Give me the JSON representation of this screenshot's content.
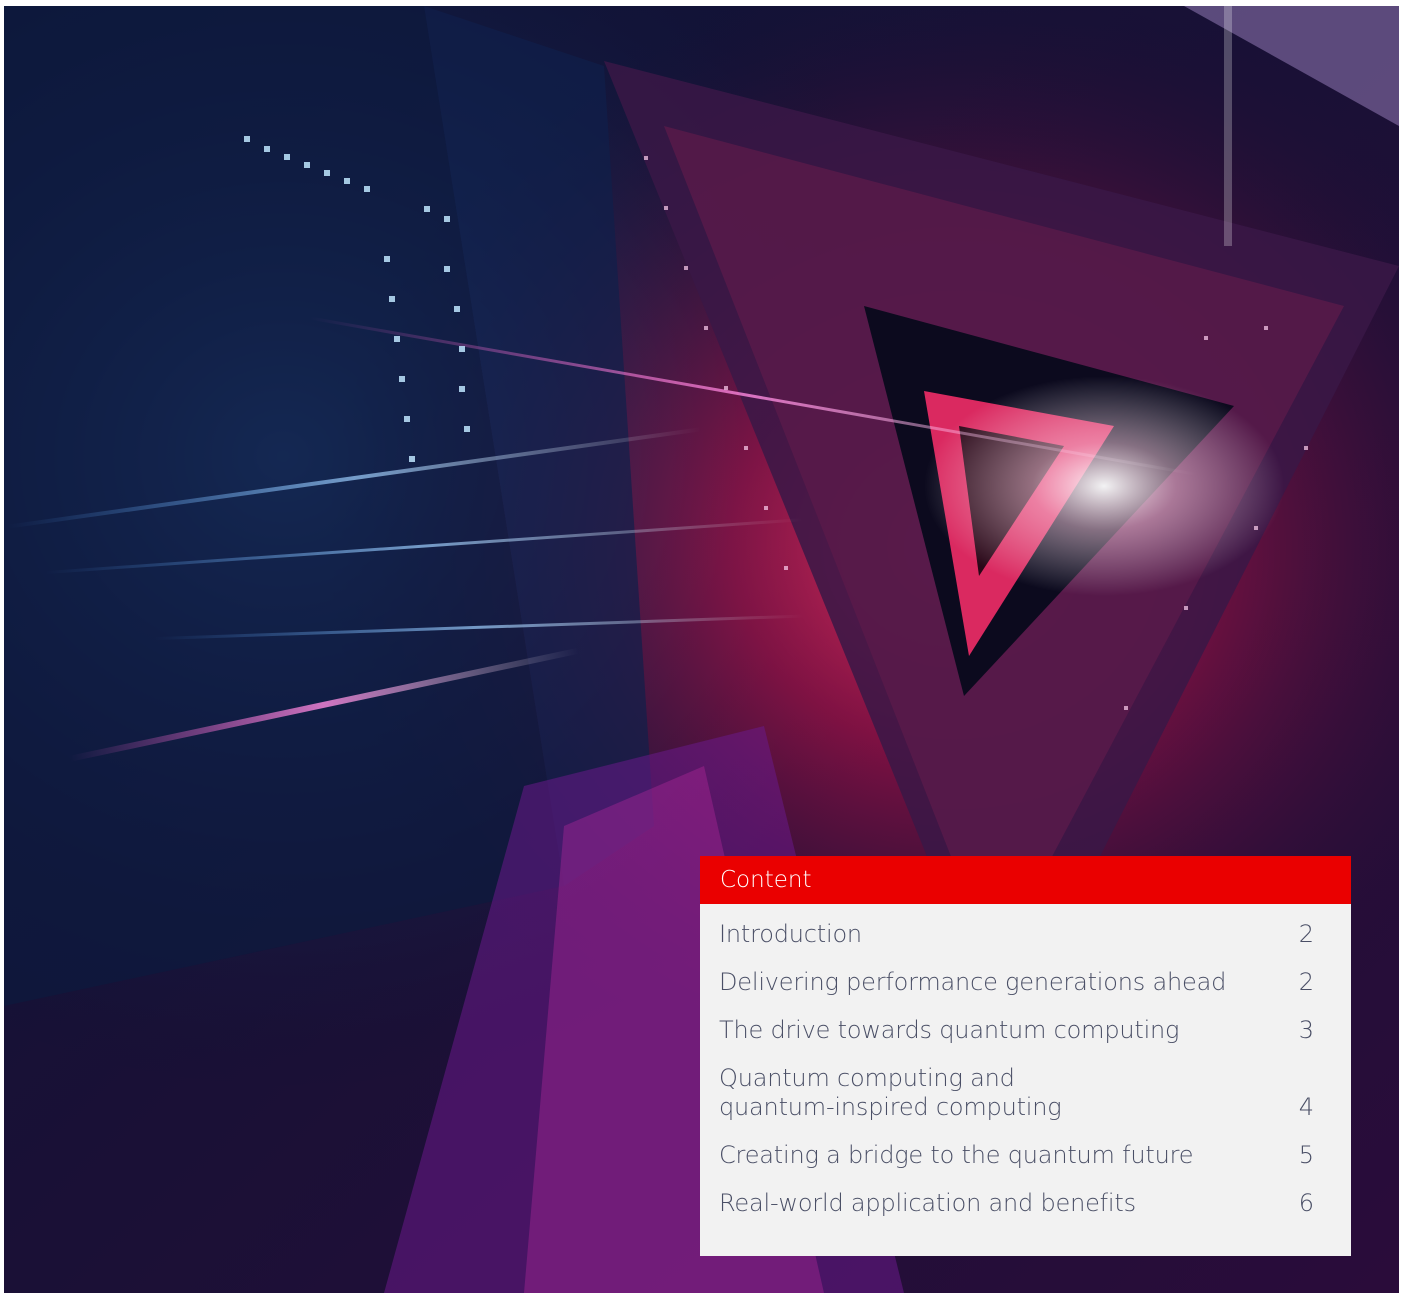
{
  "toc": {
    "header": "Content",
    "entries": [
      {
        "title": "Introduction",
        "page": "2"
      },
      {
        "title": "Delivering performance generations ahead",
        "page": "2"
      },
      {
        "title": "The drive towards quantum computing",
        "page": "3"
      },
      {
        "title": "Quantum computing and\nquantum-inspired computing",
        "page": "4"
      },
      {
        "title": "Creating a bridge to the quantum future",
        "page": "5"
      },
      {
        "title": "Real-world application and benefits",
        "page": "6"
      }
    ]
  },
  "colors": {
    "accent": "#ea0000",
    "panel": "#f2f2f2",
    "text": "#4a4f66"
  }
}
